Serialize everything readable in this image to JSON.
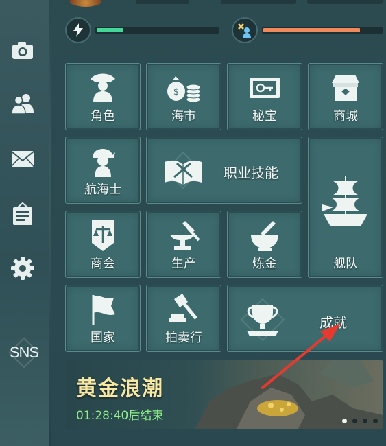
{
  "sidebar": {
    "items": [
      {
        "icon": "camera-icon"
      },
      {
        "icon": "friends-icon"
      },
      {
        "icon": "mail-icon"
      },
      {
        "icon": "notice-board-icon"
      },
      {
        "icon": "gear-icon"
      },
      {
        "label": "SNS"
      }
    ]
  },
  "status": {
    "energy_icon": "lightning-icon",
    "energy_progress": 0.22,
    "energy_color": "#43d79a",
    "work_icon": "worker-icon",
    "work_progress": 0.82,
    "work_color": "#f08a5d"
  },
  "menu": {
    "role": "角色",
    "market": "海市",
    "treasure": "秘宝",
    "mall": "商城",
    "sailor": "航海士",
    "career_skill": "职业技能",
    "fleet": "舰队",
    "guild": "商会",
    "production": "生产",
    "alchemy": "炼金",
    "nation": "国家",
    "auction": "拍卖行",
    "achievement": "成就"
  },
  "banner": {
    "title": "黄金浪潮",
    "timer": "01:28:40后结束",
    "pages": 4,
    "active_page": 1
  },
  "colors": {
    "tile_bg": "#3c6a6d",
    "banner_title": "#f6e7a4",
    "timer_text": "#8ff08a",
    "arrow": "#e53b2f"
  }
}
